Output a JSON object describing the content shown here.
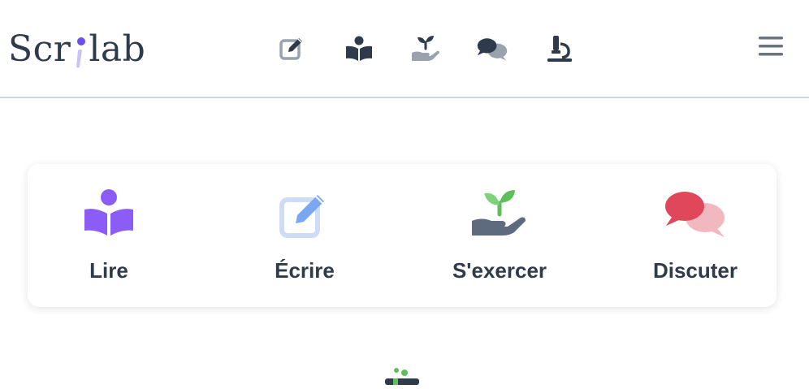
{
  "app": {
    "logo_text_before": "Scr",
    "logo_text_after": "lab"
  },
  "nav": {
    "items": [
      {
        "icon": "edit-icon",
        "label": ""
      },
      {
        "icon": "reading-icon",
        "label": ""
      },
      {
        "icon": "seedling-hand-icon",
        "label": ""
      },
      {
        "icon": "chat-icon",
        "label": ""
      },
      {
        "icon": "microscope-icon",
        "label": ""
      }
    ],
    "menu_icon": "hamburger-icon"
  },
  "tiles": [
    {
      "label": "Lire",
      "icon": "reading-icon",
      "color": "#8b5cf6"
    },
    {
      "label": "Écrire",
      "icon": "edit-icon",
      "color": "#7aa7f2"
    },
    {
      "label": "S'exercer",
      "icon": "seedling-hand-icon",
      "color": "#5fbf5a"
    },
    {
      "label": "Discuter",
      "icon": "chat-icon",
      "color": "#e0475b"
    }
  ],
  "colors": {
    "text": "#2f3a4b",
    "purple": "#8b5cf6",
    "blue": "#7aa7f2",
    "green": "#5fbf5a",
    "red": "#e0475b",
    "pink": "#f2b8bf",
    "gray": "#9aa2ad",
    "divider": "#cfd8de"
  }
}
